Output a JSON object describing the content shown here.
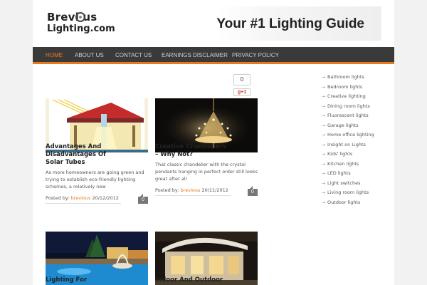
{
  "site": {
    "logo_line1": "Brevi us",
    "logo_line2": "Lighting.com",
    "banner_text": "Your #1 Lighting Guide"
  },
  "nav": {
    "items": [
      {
        "label": "HOME",
        "active": true
      },
      {
        "label": "ABOUT US",
        "active": false
      },
      {
        "label": "CONTACT US",
        "active": false
      },
      {
        "label": "EARNINGS DISCLAIMER",
        "active": false
      },
      {
        "label": "PRIVACY POLICY",
        "active": false
      }
    ]
  },
  "social": {
    "share_count": "0",
    "gplus_label": "g+1"
  },
  "posts": [
    {
      "title_lines": [
        "Advantages And",
        "Disadvantages Of",
        "Solar Tubes"
      ],
      "excerpt_lines": [
        "As more homeowners are going green and",
        "trying to establish eco-friendly lighting",
        "schemes, a relatively new"
      ],
      "posted_by": "Posted by:",
      "author": "brevious",
      "date": "20/12/2012",
      "comments": "0"
    },
    {
      "title_lines": [
        "Creative Chandeliers",
        "– Why Not?"
      ],
      "excerpt_lines": [
        "That classic chandelier with the crystal",
        "pendants hanging in perfect order still looks",
        "great after all"
      ],
      "posted_by": "Posted by:",
      "author": "brevious",
      "date": "20/11/2012",
      "comments": "0"
    },
    {
      "title_lines": [
        "Lighting For"
      ]
    },
    {
      "title_lines": [
        "Indoor And Outdoor"
      ]
    }
  ],
  "sidebar": {
    "categories": [
      "Bathroom lights",
      "Bedroom lights",
      "Creative lighting",
      "Dining room lights",
      "Fluorescent lights",
      "Garage lights",
      "Home office lighting",
      "Insight on Lights",
      "Kids' lights",
      "Kitchen lights",
      "LED lights",
      "Light switches",
      "Living room lights",
      "Outdoor lights"
    ]
  },
  "colors": {
    "accent": "#e87a1e",
    "nav_bg": "#3a3a3a"
  }
}
